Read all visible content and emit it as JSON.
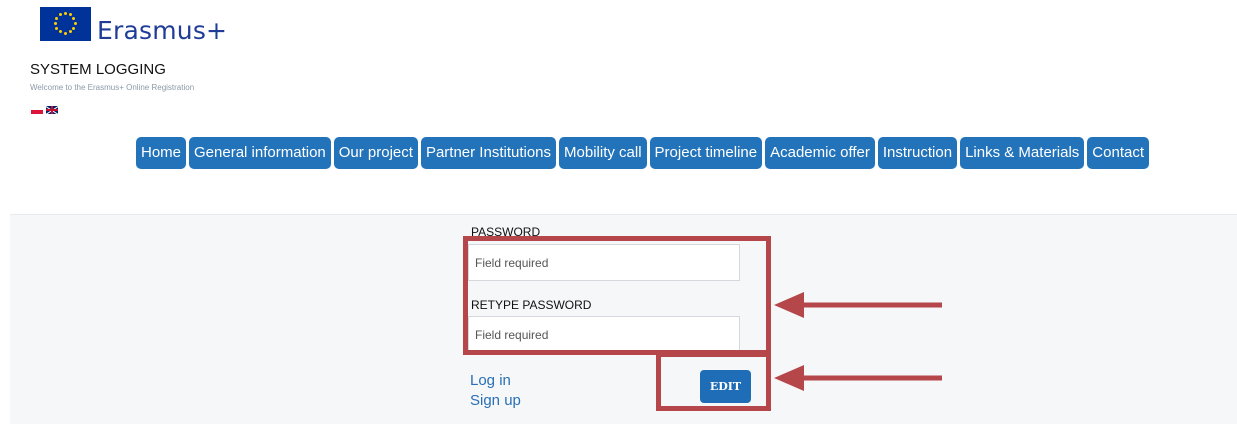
{
  "header": {
    "logo_text": "Erasmus+",
    "title": "SYSTEM LOGGING",
    "subtitle": "Welcome to the Erasmus+ Online Registration"
  },
  "languages": [
    {
      "code": "pl",
      "icon": "flag-pl-icon"
    },
    {
      "code": "en",
      "icon": "flag-gb-icon"
    }
  ],
  "nav": {
    "items": [
      "Home",
      "General information",
      "Our project",
      "Partner Institutions",
      "Mobility call",
      "Project timeline",
      "Academic offer",
      "Instruction",
      "Links & Materials",
      "Contact"
    ]
  },
  "form": {
    "password_label": "PASSWORD",
    "password_placeholder": "Field required",
    "retype_label": "RETYPE PASSWORD",
    "retype_placeholder": "Field required",
    "login_link": "Log in",
    "signup_link": "Sign up",
    "edit_button": "EDIT"
  },
  "colors": {
    "nav_bg": "#2273b9",
    "brand_blue": "#003399",
    "annotation": "#b5474a"
  }
}
